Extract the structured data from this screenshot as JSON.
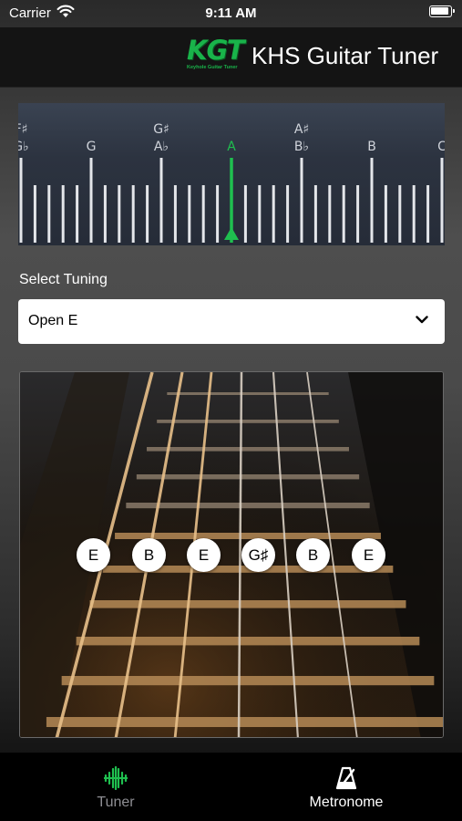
{
  "status_bar": {
    "carrier": "Carrier",
    "time": "9:11 AM"
  },
  "header": {
    "logo_text": "KGT",
    "logo_subtitle": "Keyhole Guitar Tuner",
    "title": "KHS Guitar Tuner",
    "brand_color": "#19b34a"
  },
  "meter": {
    "note_labels": [
      {
        "top": "",
        "bottom": "F♯ / G♭",
        "top_text": "F♯",
        "bottom_text": "G♭"
      },
      {
        "top_text": "",
        "bottom_text": "G"
      },
      {
        "top_text": "G♯",
        "bottom_text": "A♭"
      },
      {
        "top_text": "",
        "bottom_text": "A"
      },
      {
        "top_text": "A♯",
        "bottom_text": "B♭"
      },
      {
        "top_text": "",
        "bottom_text": "B"
      },
      {
        "top_text": "",
        "bottom_text": "C"
      }
    ],
    "active_note": "A",
    "indicator_color": "#1fbf4f"
  },
  "tuning": {
    "label": "Select Tuning",
    "selected": "Open E"
  },
  "strings": [
    "E",
    "B",
    "E",
    "G♯",
    "B",
    "E"
  ],
  "tabs": [
    {
      "label": "Tuner",
      "icon": "waveform-icon",
      "selected": true
    },
    {
      "label": "Metronome",
      "icon": "metronome-icon",
      "selected": false
    }
  ]
}
